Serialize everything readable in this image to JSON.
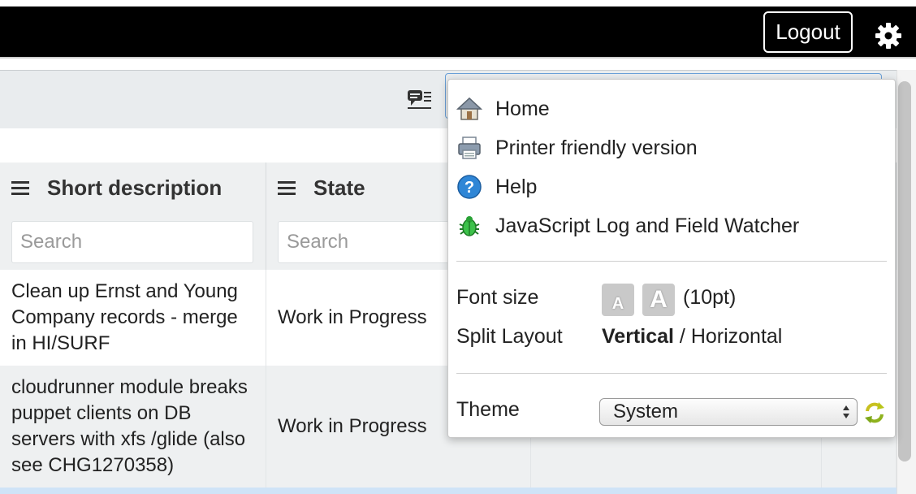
{
  "header": {
    "logout_label": "Logout"
  },
  "table": {
    "columns": [
      {
        "label": "Short description",
        "search_placeholder": "Search"
      },
      {
        "label": "State",
        "search_placeholder": "Search"
      }
    ],
    "rows": [
      {
        "short_description": "Clean up Ernst and Young Company records - merge in HI/SURF",
        "state": "Work in Progress"
      },
      {
        "short_description": "cloudrunner module breaks puppet clients on DB servers with xfs /glide (also see CHG1270358)",
        "state": "Work in Progress"
      }
    ]
  },
  "menu": {
    "items": [
      {
        "label": "Home",
        "icon": "home-icon"
      },
      {
        "label": "Printer friendly version",
        "icon": "printer-icon"
      },
      {
        "label": "Help",
        "icon": "help-icon"
      },
      {
        "label": "JavaScript Log and Field Watcher",
        "icon": "bug-icon"
      }
    ],
    "font_size": {
      "label": "Font size",
      "decrease_glyph": "A",
      "increase_glyph": "A",
      "value": "(10pt)"
    },
    "split_layout": {
      "label": "Split Layout",
      "selected": "Vertical",
      "separator": "/",
      "other": "Horizontal"
    },
    "theme": {
      "label": "Theme",
      "value": "System"
    }
  },
  "colors": {
    "header_bg": "#000000",
    "toolbar_bg": "#e9ecee",
    "header_cell_bg": "#eef0f1",
    "odd_row_bg": "#eef0f1",
    "even_row_bg": "#ffffff",
    "selected_row_bg": "#cfe3f7",
    "menu_bg": "#ffffff"
  }
}
